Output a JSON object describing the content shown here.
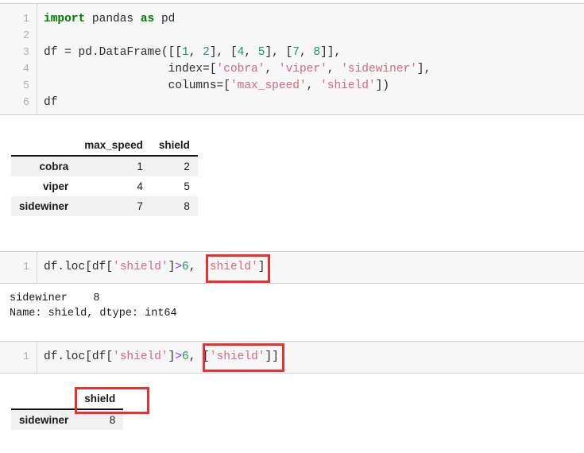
{
  "notebook": {
    "cells": [
      {
        "id": "cell-1",
        "line_numbers": [
          "1",
          "2",
          "3",
          "4",
          "5",
          "6"
        ],
        "lines": [
          [
            {
              "t": "import",
              "c": "kw"
            },
            {
              "t": " pandas ",
              "c": "plain"
            },
            {
              "t": "as",
              "c": "kw"
            },
            {
              "t": " pd",
              "c": "plain"
            }
          ],
          [],
          [
            {
              "t": "df = pd.DataFrame([[",
              "c": "plain"
            },
            {
              "t": "1",
              "c": "num"
            },
            {
              "t": ", ",
              "c": "plain"
            },
            {
              "t": "2",
              "c": "num"
            },
            {
              "t": "], [",
              "c": "plain"
            },
            {
              "t": "4",
              "c": "num"
            },
            {
              "t": ", ",
              "c": "plain"
            },
            {
              "t": "5",
              "c": "num"
            },
            {
              "t": "], [",
              "c": "plain"
            },
            {
              "t": "7",
              "c": "num"
            },
            {
              "t": ", ",
              "c": "plain"
            },
            {
              "t": "8",
              "c": "num"
            },
            {
              "t": "]],",
              "c": "plain"
            }
          ],
          [
            {
              "t": "                  index=[",
              "c": "plain"
            },
            {
              "t": "'cobra'",
              "c": "str"
            },
            {
              "t": ", ",
              "c": "plain"
            },
            {
              "t": "'viper'",
              "c": "str"
            },
            {
              "t": ", ",
              "c": "plain"
            },
            {
              "t": "'sidewiner'",
              "c": "str"
            },
            {
              "t": "],",
              "c": "plain"
            }
          ],
          [
            {
              "t": "                  columns=[",
              "c": "plain"
            },
            {
              "t": "'max_speed'",
              "c": "str"
            },
            {
              "t": ", ",
              "c": "plain"
            },
            {
              "t": "'shield'",
              "c": "str"
            },
            {
              "t": "])",
              "c": "plain"
            }
          ],
          [
            {
              "t": "df",
              "c": "plain"
            }
          ]
        ]
      },
      {
        "id": "cell-2",
        "line_numbers": [
          "1"
        ],
        "lines": [
          [
            {
              "t": "df.loc[df[",
              "c": "plain"
            },
            {
              "t": "'shield'",
              "c": "str"
            },
            {
              "t": "]",
              "c": "plain"
            },
            {
              "t": ">",
              "c": "op"
            },
            {
              "t": "6",
              "c": "num"
            },
            {
              "t": ", ",
              "c": "plain"
            },
            {
              "t": "'shield'",
              "c": "str"
            },
            {
              "t": "]",
              "c": "plain"
            }
          ]
        ]
      },
      {
        "id": "cell-3",
        "line_numbers": [
          "1"
        ],
        "lines": [
          [
            {
              "t": "df.loc[df[",
              "c": "plain"
            },
            {
              "t": "'shield'",
              "c": "str"
            },
            {
              "t": "]",
              "c": "plain"
            },
            {
              "t": ">",
              "c": "op"
            },
            {
              "t": "6",
              "c": "num"
            },
            {
              "t": ", [",
              "c": "plain"
            },
            {
              "t": "'shield'",
              "c": "str"
            },
            {
              "t": "]]",
              "c": "plain"
            }
          ]
        ]
      }
    ]
  },
  "outputs": {
    "dataframe_full": {
      "corner": "",
      "columns": [
        "max_speed",
        "shield"
      ],
      "index": [
        "cobra",
        "viper",
        "sidewiner"
      ],
      "rows": [
        [
          "1",
          "2"
        ],
        [
          "4",
          "5"
        ],
        [
          "7",
          "8"
        ]
      ]
    },
    "series_text": "sidewiner    8\nName: shield, dtype: int64",
    "dataframe_single": {
      "corner": "",
      "columns": [
        "shield"
      ],
      "index": [
        "sidewiner"
      ],
      "rows": [
        [
          "8"
        ]
      ]
    }
  },
  "annotations": {
    "highlight_color": "#ec2f2f",
    "boxes": [
      {
        "name": "highlight-scalar-selector",
        "target": "'shield'"
      },
      {
        "name": "highlight-list-selector",
        "target": "['shield']"
      },
      {
        "name": "highlight-result-column-header",
        "target": "shield"
      }
    ]
  }
}
